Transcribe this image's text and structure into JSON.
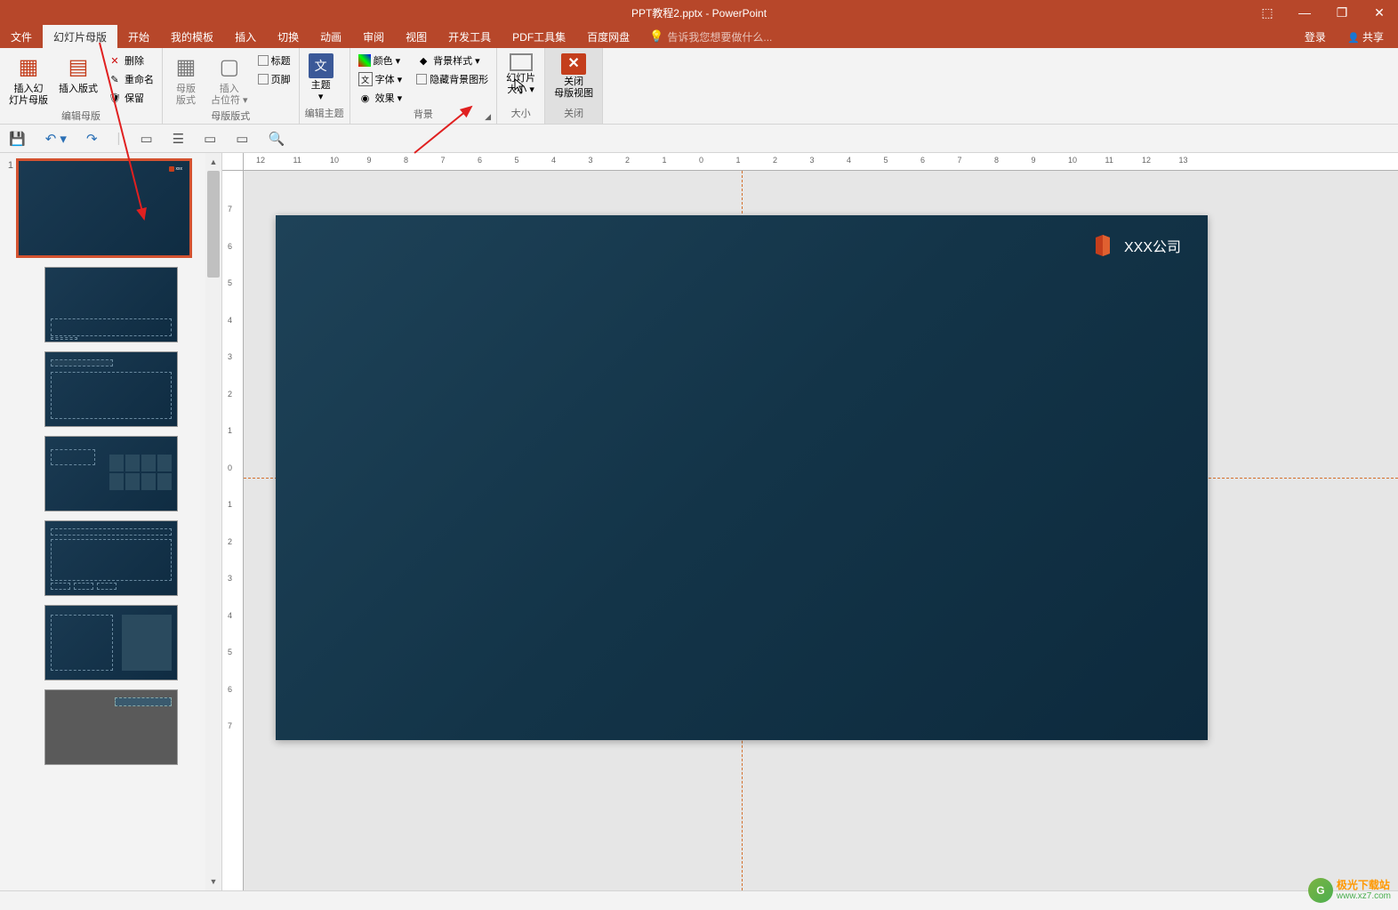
{
  "window": {
    "title": "PPT教程2.pptx - PowerPoint",
    "controls": {
      "dock": "⬚",
      "min": "—",
      "restore": "❐",
      "close": "✕"
    }
  },
  "menu": {
    "tabs": [
      "文件",
      "幻灯片母版",
      "开始",
      "我的模板",
      "插入",
      "切换",
      "动画",
      "审阅",
      "视图",
      "开发工具",
      "PDF工具集",
      "百度网盘"
    ],
    "active_index": 1,
    "tell_me": "告诉我您想要做什么...",
    "login": "登录",
    "share": "共享"
  },
  "ribbon": {
    "groups": [
      {
        "label": "编辑母版",
        "large": [
          {
            "name": "insert-slide-master",
            "label": "插入幻\n灯片母版",
            "icon": "▦"
          },
          {
            "name": "insert-layout",
            "label": "插入版式",
            "icon": "▤"
          }
        ],
        "mini": [
          {
            "name": "delete",
            "label": "删除",
            "icon": "✕"
          },
          {
            "name": "rename",
            "label": "重命名",
            "icon": "✎"
          },
          {
            "name": "preserve",
            "label": "保留",
            "icon": "🛡"
          }
        ]
      },
      {
        "label": "母版版式",
        "large": [
          {
            "name": "master-layout",
            "label": "母版\n版式",
            "icon": "▦"
          },
          {
            "name": "insert-placeholder",
            "label": "插入\n占位符",
            "icon": "▢",
            "dropdown": true
          }
        ],
        "mini": [
          {
            "name": "title-chk",
            "label": "标题",
            "checkbox": true
          },
          {
            "name": "footer-chk",
            "label": "页脚",
            "checkbox": true
          }
        ]
      },
      {
        "label": "编辑主题",
        "large": [
          {
            "name": "themes",
            "label": "主题",
            "icon": "文",
            "dropdown": true
          }
        ]
      },
      {
        "label": "背景",
        "mini_cols": [
          [
            {
              "name": "colors",
              "label": "颜色",
              "icon": "◧",
              "dropdown": true
            },
            {
              "name": "fonts",
              "label": "字体",
              "icon": "文",
              "dropdown": true
            },
            {
              "name": "effects",
              "label": "效果",
              "icon": "◉",
              "dropdown": true
            }
          ],
          [
            {
              "name": "bg-styles",
              "label": "背景样式",
              "icon": "◆",
              "dropdown": true
            },
            {
              "name": "hide-bg",
              "label": "隐藏背景图形",
              "checkbox": true
            }
          ]
        ],
        "has_launcher": true
      },
      {
        "label": "大小",
        "large": [
          {
            "name": "slide-size",
            "label": "幻灯片\n大小",
            "icon": "▭",
            "dropdown": true
          }
        ]
      },
      {
        "label": "关闭",
        "large": [
          {
            "name": "close-master-view",
            "label": "关闭\n母版视图",
            "icon": "✕",
            "closing": true
          }
        ]
      }
    ]
  },
  "qat": {
    "items": [
      "save",
      "undo",
      "redo",
      "sep",
      "from-beginning",
      "touch-mode",
      "mode2",
      "draw",
      "spell"
    ]
  },
  "ruler": {
    "h_ticks": [
      "12",
      "11",
      "10",
      "9",
      "8",
      "7",
      "6",
      "5",
      "4",
      "3",
      "2",
      "1",
      "0",
      "1",
      "2",
      "3",
      "4",
      "5",
      "6",
      "7",
      "8",
      "9",
      "10",
      "11",
      "12",
      "13"
    ],
    "v_ticks": [
      "7",
      "6",
      "5",
      "4",
      "3",
      "2",
      "1",
      "0",
      "1",
      "2",
      "3",
      "4",
      "5",
      "6",
      "7"
    ]
  },
  "slide": {
    "logo_text": "XXX公司"
  },
  "thumbnails": {
    "master_num": "1"
  },
  "watermark": {
    "line1": "极光下载站",
    "line2": "www.xz7.com"
  }
}
